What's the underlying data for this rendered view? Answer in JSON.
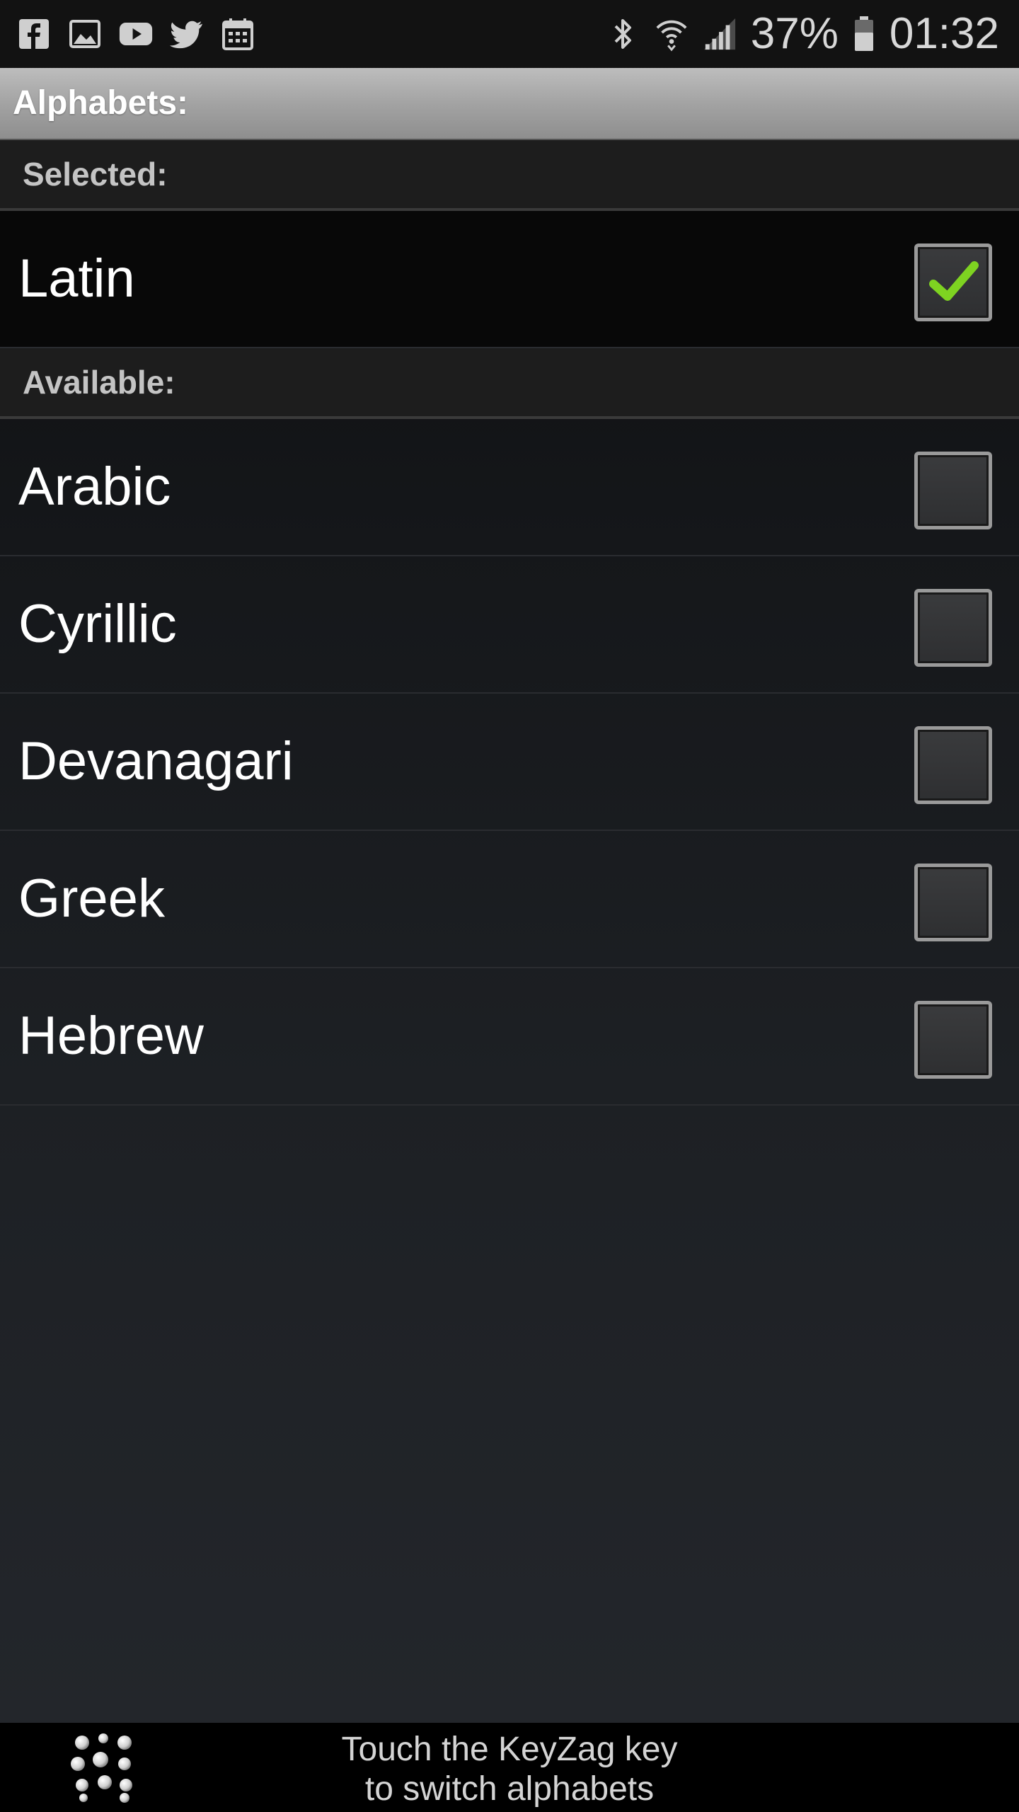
{
  "status_bar": {
    "notification_icons": [
      "facebook-icon",
      "gallery-icon",
      "youtube-icon",
      "twitter-icon",
      "calendar-icon"
    ],
    "system_icons": [
      "bluetooth-icon",
      "wifi-icon",
      "signal-icon",
      "battery-icon"
    ],
    "battery_percent": "37%",
    "time": "01:32"
  },
  "title_bar": {
    "title": "Alphabets:"
  },
  "sections": {
    "selected_label": "Selected:",
    "available_label": "Available:"
  },
  "selected_alphabets": [
    {
      "label": "Latin",
      "checked": true
    }
  ],
  "available_alphabets": [
    {
      "label": "Arabic",
      "checked": false
    },
    {
      "label": "Cyrillic",
      "checked": false
    },
    {
      "label": "Devanagari",
      "checked": false
    },
    {
      "label": "Greek",
      "checked": false
    },
    {
      "label": "Hebrew",
      "checked": false
    }
  ],
  "bottom_bar": {
    "hint_line1": "Touch the KeyZag key",
    "hint_line2": "to switch alphabets"
  },
  "colors": {
    "check_green": "#7ed321",
    "title_gray": "#a3a3a3"
  }
}
